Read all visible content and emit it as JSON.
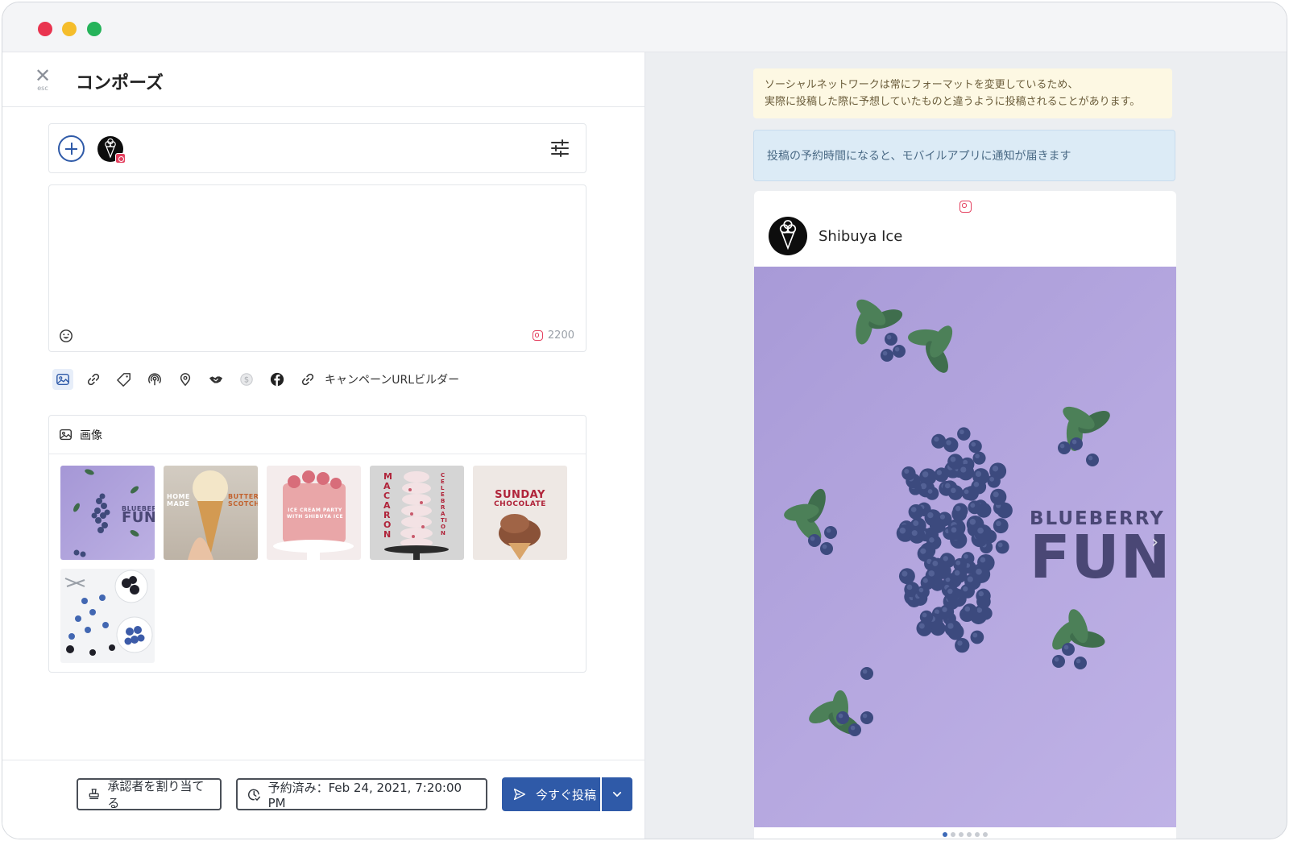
{
  "compose": {
    "close_label": "✕",
    "close_hint": "esc",
    "title": "コンポーズ",
    "char_count": "2200",
    "campaign_url_builder": "キャンペーンURLビルダー"
  },
  "images_panel": {
    "label": "画像",
    "thumbnails": [
      {
        "name": "blueberry-fun",
        "text_lines": [
          "BLUEBERRY",
          "FUN"
        ],
        "bg": "#aa9cd8"
      },
      {
        "name": "homemade-butterscotch",
        "text_lines": [
          "HOME MADE",
          "BUTTER SCOTCH"
        ],
        "bg": "#cfc5b8"
      },
      {
        "name": "ice-cream-party-cake",
        "text_lines": [
          "ICE CREAM PARTY",
          "WITH SHIBUYA ICE"
        ],
        "bg": "#ecc6c3"
      },
      {
        "name": "macaron-celebration",
        "text_lines": [
          "MACARON",
          "CELEBRATION"
        ],
        "bg": "#d6d6d6"
      },
      {
        "name": "sunday-chocolate",
        "text_lines": [
          "SUNDAY",
          "CHOCOLATE"
        ],
        "bg": "#efe9e5"
      },
      {
        "name": "blueberries-blackberries",
        "text_lines": [],
        "bg": "#f2f3f5"
      }
    ]
  },
  "footer": {
    "assign_approver": "承認者を割り当てる",
    "scheduled": "予約済み：Feb 24, 2021, 7:20:00 PM",
    "post_now": "今すぐ投稿"
  },
  "notices": {
    "yellow_line1": "ソーシャルネットワークは常にフォーマットを変更しているため、",
    "yellow_line2": "実際に投稿した際に予想していたものと違うように投稿されることがあります。",
    "blue": "投稿の予約時間になると、モバイルアプリに通知が届きます"
  },
  "preview": {
    "account_name": "Shibuya Ice",
    "image_title_line1": "BLUEBERRY",
    "image_title_line2": "FUN",
    "carousel_total": 6,
    "carousel_active": 1
  },
  "colors": {
    "primary": "#2f5aa8",
    "instagram": "#e4405f",
    "image_lavender": "#b0a2dc"
  },
  "icons": [
    "close-icon",
    "add-account-icon",
    "instagram-icon",
    "filter-sliders-icon",
    "emoji-icon",
    "image-icon",
    "link-icon",
    "tag-icon",
    "podcast-icon",
    "location-pin-icon",
    "handshake-icon",
    "dollar-icon",
    "facebook-icon",
    "stamp-icon",
    "clock-check-icon",
    "send-icon",
    "chevron-down-icon"
  ]
}
